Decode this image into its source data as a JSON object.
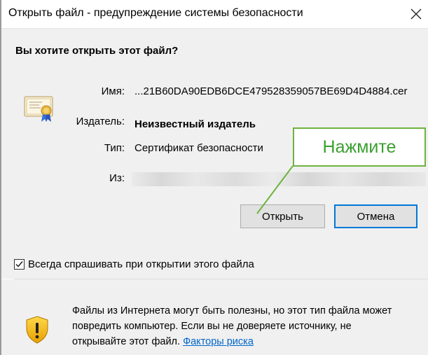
{
  "dialog": {
    "title": "Открыть файл - предупреждение системы безопасности",
    "heading": "Вы хотите открыть этот файл?",
    "fields": {
      "name_label": "Имя:",
      "name_value": "...21B60DA90EDB6DCE479528359057BE69D4D4884.cer",
      "publisher_label": "Издатель:",
      "publisher_value": "Неизвестный издатель",
      "type_label": "Тип:",
      "type_value": "Сертификат безопасности",
      "from_label": "Из:"
    },
    "buttons": {
      "open": "Открыть",
      "cancel": "Отмена"
    },
    "checkbox": {
      "label": "Всегда спрашивать при открытии этого файла",
      "checked": true
    },
    "warning": {
      "text": "Файлы из Интернета могут быть полезны, но этот тип файла может повредить компьютер. Если вы не доверяете источнику, не открывайте этот файл.",
      "link": "Факторы риска"
    }
  },
  "annotation": {
    "callout_text": "Нажмите",
    "color": "#6db33f"
  },
  "icons": [
    "certificate-icon",
    "shield-warning-icon",
    "close-icon",
    "checkmark-icon"
  ]
}
